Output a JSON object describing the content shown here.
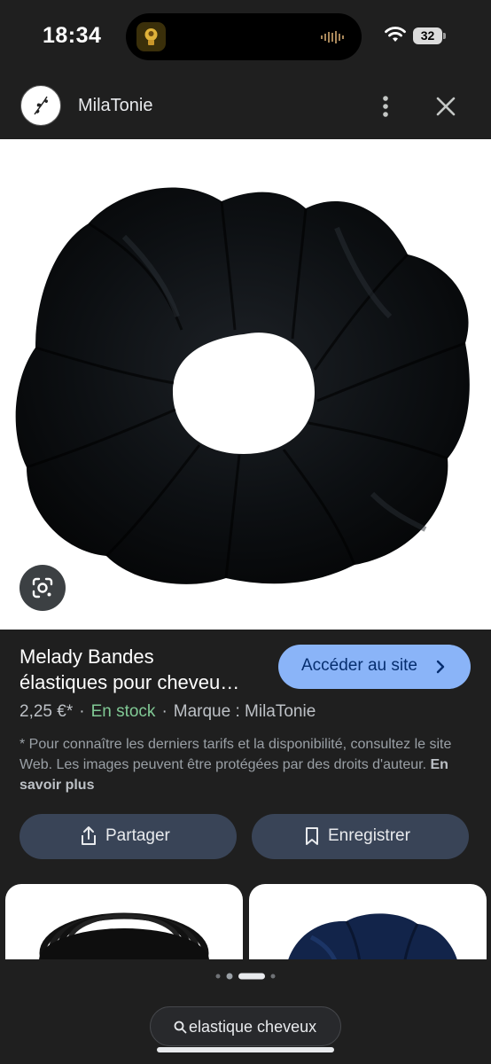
{
  "status_bar": {
    "time": "18:34",
    "battery": "32"
  },
  "header": {
    "site_name": "MilaTonie"
  },
  "product": {
    "title_line1": "Melady Bandes",
    "title_line2": "élastiques pour cheveu…",
    "visit_label": "Accéder au site",
    "price": "2,25 €*",
    "stock": "En stock",
    "brand": "Marque : MilaTonie",
    "disclaimer": "* Pour connaître les derniers tarifs et la disponibilité, consultez le site Web. Les images peuvent être protégées par des droits d'auteur.",
    "learn_more": "En savoir plus"
  },
  "actions": {
    "share_label": "Partager",
    "save_label": "Enregistrer"
  },
  "search": {
    "query": "elastique cheveux"
  },
  "colors": {
    "accent": "#8ab4f8",
    "stock_green": "#81c995",
    "background": "#1f1f1f",
    "action_button": "#394457"
  },
  "icons": [
    "wifi-icon",
    "battery-icon",
    "more-vert-icon",
    "close-icon",
    "google-lens-icon",
    "share-icon",
    "bookmark-icon",
    "search-icon",
    "chevron-right-icon"
  ]
}
